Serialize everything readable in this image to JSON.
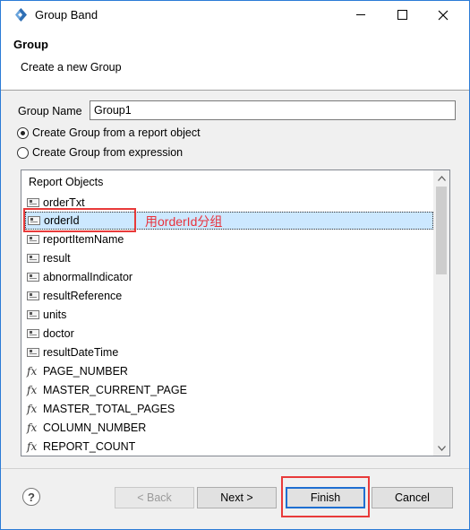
{
  "window": {
    "title": "Group Band",
    "minimize_icon": "minimize-icon",
    "maximize_icon": "maximize-icon",
    "close_icon": "close-icon"
  },
  "banner": {
    "title": "Group",
    "message": "Create a new Group"
  },
  "form": {
    "group_name_label": "Group Name",
    "group_name_value": "Group1",
    "radio_report_object": "Create Group from a report object",
    "radio_expression": "Create Group from expression",
    "selected_option": "report_object"
  },
  "tree": {
    "header": "Report Objects",
    "annotation": "用orderId分组",
    "items": [
      {
        "label": "orderTxt",
        "icon": "field-icon"
      },
      {
        "label": "orderId",
        "icon": "field-icon",
        "selected": true
      },
      {
        "label": "reportItemName",
        "icon": "field-icon"
      },
      {
        "label": "result",
        "icon": "field-icon"
      },
      {
        "label": "abnormalIndicator",
        "icon": "field-icon"
      },
      {
        "label": "resultReference",
        "icon": "field-icon"
      },
      {
        "label": "units",
        "icon": "field-icon"
      },
      {
        "label": "doctor",
        "icon": "field-icon"
      },
      {
        "label": "resultDateTime",
        "icon": "field-icon"
      },
      {
        "label": "PAGE_NUMBER",
        "icon": "function-icon"
      },
      {
        "label": "MASTER_CURRENT_PAGE",
        "icon": "function-icon"
      },
      {
        "label": "MASTER_TOTAL_PAGES",
        "icon": "function-icon"
      },
      {
        "label": "COLUMN_NUMBER",
        "icon": "function-icon"
      },
      {
        "label": "REPORT_COUNT",
        "icon": "function-icon"
      }
    ]
  },
  "buttons": {
    "help": "?",
    "back": "< Back",
    "next": "Next >",
    "finish": "Finish",
    "cancel": "Cancel"
  },
  "colors": {
    "selection": "#cce8ff",
    "annotation": "#e8323c",
    "focus_border": "#1f6fd1"
  }
}
